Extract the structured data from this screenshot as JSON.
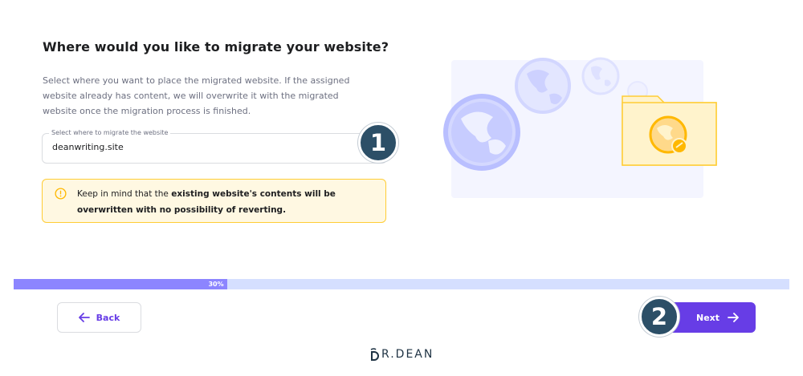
{
  "page": {
    "title": "Where would you like to migrate your website?",
    "description": "Select where you want to place the migrated website. If the assigned website already has content, we will overwrite it with the migrated website once the migration process is finished."
  },
  "field": {
    "label": "Select where to migrate the website",
    "value": "deanwriting.site"
  },
  "warning": {
    "prefix": "Keep in mind that the ",
    "bold": "existing website's contents will be overwritten with no possibility of reverting."
  },
  "annotations": {
    "badge_1": "1",
    "badge_2": "2"
  },
  "progress": {
    "percent": 30,
    "label": "30%"
  },
  "buttons": {
    "back": "Back",
    "next": "Next"
  },
  "logo": {
    "text": "R.DEAN"
  },
  "icons": {
    "warning": "alert-circle-icon",
    "back": "arrow-left-icon",
    "next": "arrow-right-icon"
  },
  "colors": {
    "accent": "#673de6",
    "progress_fill": "#8c85ff",
    "progress_track": "#d5dfff",
    "warning_bg": "#fff8e2",
    "warning_border": "#ffcd35",
    "badge": "#2c4f67"
  }
}
